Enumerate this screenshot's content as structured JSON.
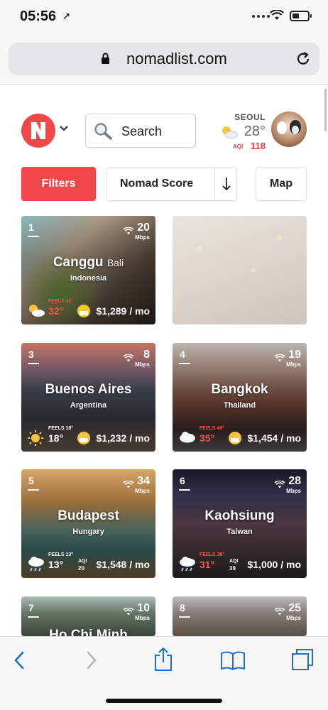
{
  "status_bar": {
    "time": "05:56"
  },
  "browser": {
    "url": "nomadlist.com"
  },
  "header": {
    "search_label": "Search",
    "weather": {
      "city": "SEOUL",
      "temp": "28°",
      "aqi_label": "AQI",
      "aqi_value": "118"
    }
  },
  "toolbar": {
    "filters": "Filters",
    "sort": "Nomad Score",
    "sort_arrow": "↓",
    "map": "Map"
  },
  "cards": [
    {
      "rank": "1",
      "speed": "20",
      "speed_unit": "Mbps",
      "city": "Canggu",
      "region": "Bali",
      "country": "Indonesia",
      "feels": "FEELS 41°",
      "temp": "32°",
      "cost": "$1,289 / mo"
    },
    {
      "rank": "3",
      "speed": "8",
      "speed_unit": "Mbps",
      "city": "Buenos Aires",
      "country": "Argentina",
      "feels": "FEELS 18°",
      "temp": "18°",
      "cost": "$1,232 / mo"
    },
    {
      "rank": "4",
      "speed": "19",
      "speed_unit": "Mbps",
      "city": "Bangkok",
      "country": "Thailand",
      "feels": "FEELS 49°",
      "temp": "35°",
      "cost": "$1,454 / mo"
    },
    {
      "rank": "5",
      "speed": "34",
      "speed_unit": "Mbps",
      "city": "Budapest",
      "country": "Hungary",
      "feels": "FEELS 13°",
      "temp": "13°",
      "aqi_label": "AQI",
      "aqi": "20",
      "cost": "$1,548 / mo"
    },
    {
      "rank": "6",
      "speed": "28",
      "speed_unit": "Mbps",
      "city": "Kaohsiung",
      "country": "Taiwan",
      "feels": "FEELS 38°",
      "temp": "31°",
      "aqi_label": "AQI",
      "aqi": "39",
      "cost": "$1,000 / mo"
    },
    {
      "rank": "7",
      "speed": "10",
      "speed_unit": "Mbps",
      "city": "Ho Chi Minh"
    },
    {
      "rank": "8",
      "speed": "25",
      "speed_unit": "Mbps"
    }
  ],
  "icons": {
    "logo": "nomadlist-logo-icon",
    "search": "search-icon",
    "wifi": "wifi-icon",
    "weather_sun": "sun-icon",
    "weather_partly": "partly-cloudy-icon",
    "weather_rain": "rain-cloud-icon",
    "aqi_face": "masked-face-icon",
    "nav_back": "back-icon",
    "nav_forward": "forward-icon",
    "share": "share-icon",
    "bookmarks": "bookmarks-icon",
    "tabs": "tabs-icon"
  },
  "colors": {
    "accent": "#f04848",
    "hot_text": "#ff4d4d",
    "ios_blue": "#1a6fd1"
  }
}
